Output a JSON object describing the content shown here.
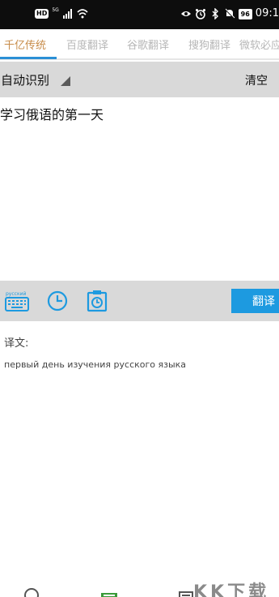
{
  "status_bar": {
    "hd_badge": "HD",
    "signal_label": "5G",
    "battery": "96",
    "time": "09:1"
  },
  "tabs": [
    {
      "label": "千亿传统"
    },
    {
      "label": "百度翻译"
    },
    {
      "label": "谷歌翻译"
    },
    {
      "label": "搜狗翻译"
    },
    {
      "label": "微软必应"
    }
  ],
  "language": {
    "source_label": "自动识别",
    "clear_label": "清空"
  },
  "input": {
    "text": "学习俄语的第一天"
  },
  "toolbar": {
    "keyboard_label": "русский",
    "translate_label": "翻译"
  },
  "result": {
    "label": "译文:",
    "text": "первый день изучения русского языка"
  },
  "watermark": {
    "text": "KK下载"
  },
  "colors": {
    "accent_blue": "#1d9ae0",
    "tab_active": "#c78b48",
    "bar_gray": "#d9d9d9"
  }
}
